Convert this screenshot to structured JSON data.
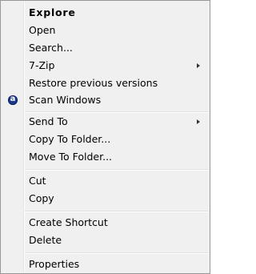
{
  "context_menu": {
    "items": [
      {
        "label": "Explore",
        "bold": true
      },
      {
        "label": "Open"
      },
      {
        "label": "Search..."
      },
      {
        "label": "7-Zip",
        "submenu": true
      },
      {
        "label": "Restore previous versions"
      },
      {
        "label": "Scan Windows",
        "icon": "antivirus-a-icon"
      },
      {
        "label": "Send To",
        "submenu": true
      },
      {
        "label": "Copy To Folder..."
      },
      {
        "label": "Move To Folder..."
      },
      {
        "label": "Cut"
      },
      {
        "label": "Copy"
      },
      {
        "label": "Create Shortcut"
      },
      {
        "label": "Delete"
      },
      {
        "label": "Properties"
      }
    ]
  },
  "colors": {
    "menu_background": "#f0f0f0",
    "menu_border": "#979797",
    "icon_blue": "#1a3a8c"
  }
}
